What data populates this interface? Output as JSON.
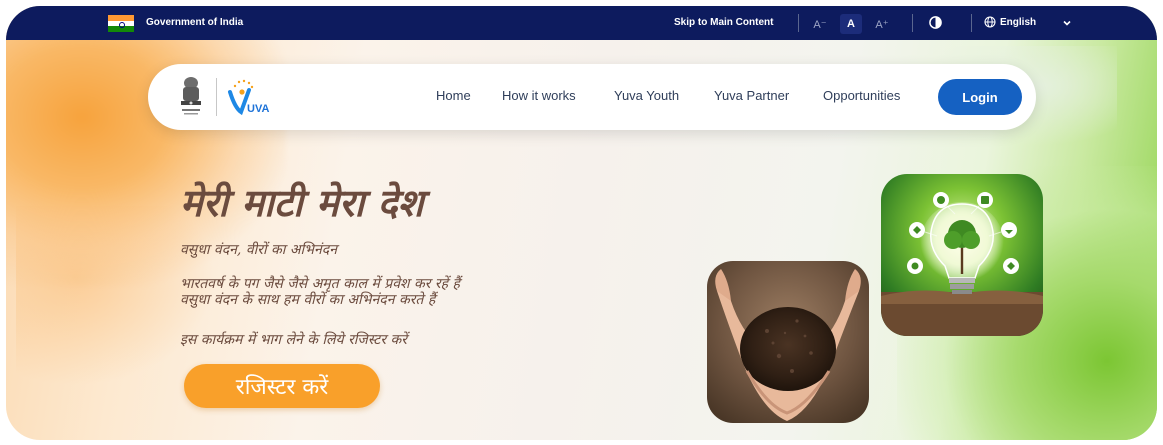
{
  "topbar": {
    "gov_label": "Government of India",
    "skip_label": "Skip to Main Content",
    "font_small": "A⁻",
    "font_normal": "A",
    "font_large": "A⁺",
    "language": "English",
    "colors": {
      "background": "#0d1b5e"
    }
  },
  "nav": {
    "home": "Home",
    "how_it_works": "How it works",
    "yuva_youth": "Yuva Youth",
    "yuva_partner": "Yuva Partner",
    "opportunities": "Opportunities",
    "login": "Login",
    "logo_text": "UVA",
    "colors": {
      "login": "#1561c2"
    }
  },
  "hero": {
    "title": "मेरी माटी मेरा देश",
    "subtitle": "वसुधा वंदन, वीरों का अभिनंदन",
    "line1": "भारतवर्ष के पग जैसे जैसे अमृत काल में प्रवेश कर रहें हैं",
    "line2": "वसुधा वंदन के साथ हम वीरों का अभिनंदन करते हैं",
    "line3": "इस कार्यक्रम में भाग लेने के लिये रजिस्टर करें",
    "register": "रजिस्टर करें",
    "colors": {
      "register": "#f9a02a",
      "text": "#6b4b3e"
    }
  },
  "icons": [
    "india-flag-icon",
    "contrast-icon",
    "globe-icon",
    "chevron-down-icon",
    "national-emblem-icon",
    "yuva-logo-icon"
  ]
}
